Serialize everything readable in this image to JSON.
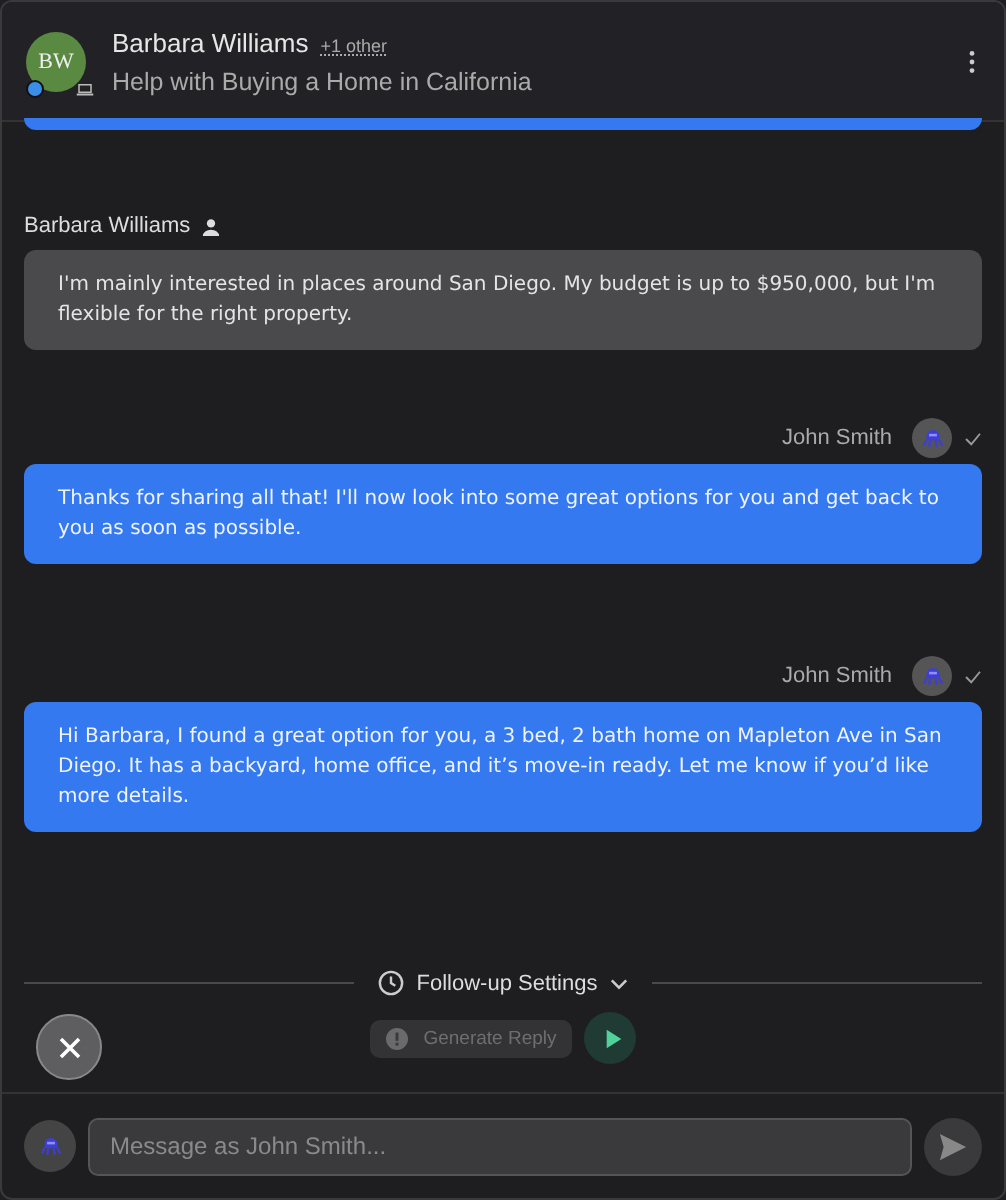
{
  "header": {
    "avatar_initials": "BW",
    "name": "Barbara Williams",
    "others": "+1 other",
    "subject": "Help with Buying a Home in California"
  },
  "messages": [
    {
      "kind": "agent",
      "partial": true
    },
    {
      "kind": "customer",
      "sender": "Barbara Williams",
      "text": "I'm mainly interested in places around San Diego. My budget is up to $950,000, but I'm flexible for the right property."
    },
    {
      "kind": "agent",
      "sender": "John Smith",
      "delivered": true,
      "text": "Thanks for sharing all that! I'll now look into some great options for you and get back to you as soon as possible."
    },
    {
      "kind": "agent",
      "sender": "John Smith",
      "delivered": true,
      "text": "Hi Barbara, I found a great option for you, a 3 bed, 2 bath home on Mapleton Ave in San Diego. It has a backyard, home office, and it’s move-in ready. Let me know if you’d like more details."
    }
  ],
  "follow_up": {
    "label": "Follow-up Settings",
    "expanded": false
  },
  "generate_button": {
    "label": "Generate Reply",
    "disabled": true
  },
  "composer": {
    "placeholder": "Message as John Smith..."
  }
}
